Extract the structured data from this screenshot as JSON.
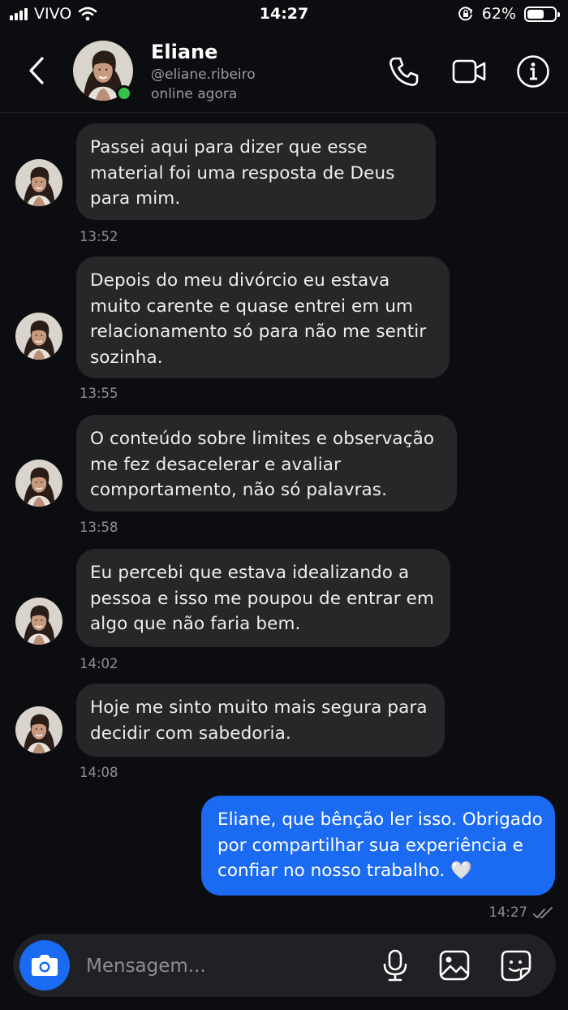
{
  "status_bar": {
    "carrier": "VIVO",
    "time": "14:27",
    "battery_percent": "62%",
    "battery_level": 0.62,
    "icons": [
      "signal-icon",
      "wifi-icon",
      "orientation-lock-icon",
      "battery-icon"
    ]
  },
  "header": {
    "name": "Eliane",
    "handle": "@eliane.ribeiro",
    "status": "online agora",
    "icons": [
      "back-icon",
      "phone-icon",
      "video-icon",
      "info-icon"
    ],
    "online_color": "#35c24a"
  },
  "messages": [
    {
      "lines": [
        "Passei aqui para dizer que esse",
        "material foi uma resposta de Deus",
        "para mim."
      ],
      "time": "13:52"
    },
    {
      "lines": [
        "Depois do meu divórcio eu estava",
        "muito carente e quase entrei em um",
        "relacionamento só para não me sentir",
        "sozinha."
      ],
      "time": "13:55"
    },
    {
      "lines": [
        "O conteúdo sobre limites e observação",
        "me fez desacelerar e avaliar",
        "comportamento, não só palavras."
      ],
      "time": "13:58"
    },
    {
      "lines": [
        "Eu percebi que estava idealizando a",
        "pessoa e isso me poupou de entrar em",
        "algo que não faria bem."
      ],
      "time": "14:02"
    },
    {
      "lines": [
        "Hoje me sinto muito mais segura para",
        "decidir com sabedoria."
      ],
      "time": "14:08"
    }
  ],
  "outgoing": {
    "lines": [
      "Eliane, que bênção ler isso. Obrigado",
      "por compartilhar sua experiência e",
      "confiar no nosso trabalho. 🤍"
    ],
    "time": "14:27",
    "receipt_icon": "double-check-icon"
  },
  "composer": {
    "placeholder": "Mensagem...",
    "value": "",
    "icons": [
      "camera-icon",
      "microphone-icon",
      "gallery-icon",
      "sticker-icon"
    ]
  },
  "colors": {
    "background": "#0c0d10",
    "incoming_bubble": "#262729",
    "outgoing_bubble": "#1a6af2",
    "composer": "#202124"
  }
}
